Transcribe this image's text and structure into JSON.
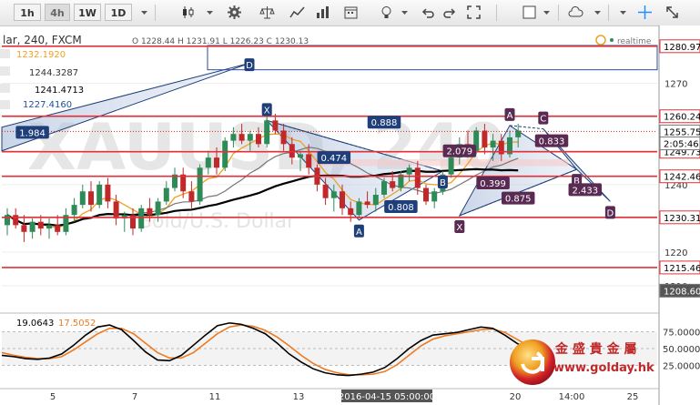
{
  "toolbar": {
    "timeframes": [
      "1h",
      "4h",
      "1W",
      "1D"
    ],
    "active_timeframe": "4h",
    "icons": [
      "dropdown-icon",
      "candlestick-icon",
      "dropdown-icon",
      "gear-icon",
      "scales-icon",
      "line-chart-icon",
      "bar-chart-icon",
      "calendar-icon",
      "lightbulb-icon",
      "dropdown-icon",
      "undo-icon",
      "redo-icon",
      "fullscreen-icon",
      "square-icon",
      "dropdown-icon",
      "cloud-icon",
      "dropdown-icon",
      "crosshair-icon",
      "expand-icon"
    ]
  },
  "header": {
    "symbol": "lar, 240, FXCM",
    "ohlc": "O 1228.44 H 1231.91 L 1226.23 C 1230.13",
    "indicator_values": [
      "1232.1920",
      "1244.3287",
      "1241.4713",
      "1227.4160"
    ],
    "indicator_colors": [
      "#f0a020",
      "#777777",
      "#000000",
      "#1f4e9c"
    ],
    "realtime_label": "realtime"
  },
  "watermark": {
    "big": "XAUUSD, 240",
    "small": "Gold/U.S. Dollar"
  },
  "colors": {
    "bull": "#2e8b57",
    "bear": "#c0282a",
    "pattern": "#1f3f7a",
    "resistance": "#e0323a",
    "ma_fast": "#f0a020",
    "ma_slow": "#777777",
    "ma_long": "#000000",
    "stoch_k": "#000000",
    "stoch_d": "#ee7a22"
  },
  "chart_data": {
    "type": "candlestick",
    "price_axis": {
      "ticks": [
        1270,
        1260,
        1250,
        1240,
        1230,
        1220,
        1210
      ],
      "ylim": [
        1202.5,
        1285.5
      ]
    },
    "x_axis": {
      "tick_labels": [
        "5",
        "7",
        "11",
        "13",
        "2016-04-15 05:00:00",
        "20",
        "14:00",
        "25"
      ]
    },
    "candles": [
      {
        "o": 1228,
        "h": 1233,
        "l": 1225,
        "c": 1231
      },
      {
        "o": 1231,
        "h": 1233,
        "l": 1227,
        "c": 1228
      },
      {
        "o": 1228,
        "h": 1231,
        "l": 1223,
        "c": 1226
      },
      {
        "o": 1226,
        "h": 1230,
        "l": 1224,
        "c": 1229
      },
      {
        "o": 1229,
        "h": 1231,
        "l": 1225,
        "c": 1227
      },
      {
        "o": 1227,
        "h": 1230,
        "l": 1224,
        "c": 1228
      },
      {
        "o": 1228,
        "h": 1231,
        "l": 1225,
        "c": 1226
      },
      {
        "o": 1226,
        "h": 1233,
        "l": 1225,
        "c": 1231
      },
      {
        "o": 1231,
        "h": 1236,
        "l": 1229,
        "c": 1234
      },
      {
        "o": 1234,
        "h": 1240,
        "l": 1233,
        "c": 1238
      },
      {
        "o": 1238,
        "h": 1241,
        "l": 1232,
        "c": 1234
      },
      {
        "o": 1234,
        "h": 1241,
        "l": 1233,
        "c": 1240
      },
      {
        "o": 1240,
        "h": 1242,
        "l": 1233,
        "c": 1235
      },
      {
        "o": 1235,
        "h": 1237,
        "l": 1228,
        "c": 1230
      },
      {
        "o": 1230,
        "h": 1232,
        "l": 1226,
        "c": 1231
      },
      {
        "o": 1231,
        "h": 1233,
        "l": 1225,
        "c": 1227
      },
      {
        "o": 1227,
        "h": 1234,
        "l": 1226,
        "c": 1233
      },
      {
        "o": 1233,
        "h": 1236,
        "l": 1229,
        "c": 1231
      },
      {
        "o": 1231,
        "h": 1236,
        "l": 1229,
        "c": 1235
      },
      {
        "o": 1235,
        "h": 1241,
        "l": 1234,
        "c": 1239
      },
      {
        "o": 1239,
        "h": 1245,
        "l": 1238,
        "c": 1243
      },
      {
        "o": 1243,
        "h": 1245,
        "l": 1236,
        "c": 1238
      },
      {
        "o": 1238,
        "h": 1241,
        "l": 1233,
        "c": 1235
      },
      {
        "o": 1235,
        "h": 1246,
        "l": 1234,
        "c": 1245
      },
      {
        "o": 1245,
        "h": 1250,
        "l": 1243,
        "c": 1248
      },
      {
        "o": 1248,
        "h": 1251,
        "l": 1243,
        "c": 1245
      },
      {
        "o": 1245,
        "h": 1254,
        "l": 1244,
        "c": 1253
      },
      {
        "o": 1253,
        "h": 1257,
        "l": 1251,
        "c": 1255
      },
      {
        "o": 1255,
        "h": 1258,
        "l": 1252,
        "c": 1253
      },
      {
        "o": 1253,
        "h": 1256,
        "l": 1250,
        "c": 1255
      },
      {
        "o": 1255,
        "h": 1257,
        "l": 1251,
        "c": 1252
      },
      {
        "o": 1252,
        "h": 1262,
        "l": 1251,
        "c": 1259
      },
      {
        "o": 1259,
        "h": 1261,
        "l": 1255,
        "c": 1256
      },
      {
        "o": 1256,
        "h": 1258,
        "l": 1250,
        "c": 1252
      },
      {
        "o": 1252,
        "h": 1254,
        "l": 1246,
        "c": 1248
      },
      {
        "o": 1248,
        "h": 1250,
        "l": 1244,
        "c": 1249
      },
      {
        "o": 1249,
        "h": 1252,
        "l": 1243,
        "c": 1245
      },
      {
        "o": 1245,
        "h": 1246,
        "l": 1238,
        "c": 1240
      },
      {
        "o": 1240,
        "h": 1242,
        "l": 1234,
        "c": 1236
      },
      {
        "o": 1236,
        "h": 1240,
        "l": 1232,
        "c": 1238
      },
      {
        "o": 1238,
        "h": 1240,
        "l": 1231,
        "c": 1233
      },
      {
        "o": 1233,
        "h": 1235,
        "l": 1229,
        "c": 1231
      },
      {
        "o": 1231,
        "h": 1236,
        "l": 1230,
        "c": 1235
      },
      {
        "o": 1235,
        "h": 1238,
        "l": 1233,
        "c": 1234
      },
      {
        "o": 1234,
        "h": 1239,
        "l": 1232,
        "c": 1237
      },
      {
        "o": 1237,
        "h": 1242,
        "l": 1236,
        "c": 1241
      },
      {
        "o": 1241,
        "h": 1244,
        "l": 1238,
        "c": 1239
      },
      {
        "o": 1239,
        "h": 1244,
        "l": 1238,
        "c": 1243
      },
      {
        "o": 1243,
        "h": 1246,
        "l": 1241,
        "c": 1245
      },
      {
        "o": 1245,
        "h": 1247,
        "l": 1237,
        "c": 1239
      },
      {
        "o": 1239,
        "h": 1240,
        "l": 1234,
        "c": 1235
      },
      {
        "o": 1235,
        "h": 1239,
        "l": 1233,
        "c": 1238
      },
      {
        "o": 1238,
        "h": 1244,
        "l": 1237,
        "c": 1243
      },
      {
        "o": 1243,
        "h": 1249,
        "l": 1242,
        "c": 1248
      },
      {
        "o": 1248,
        "h": 1254,
        "l": 1246,
        "c": 1252
      },
      {
        "o": 1252,
        "h": 1256,
        "l": 1248,
        "c": 1250
      },
      {
        "o": 1250,
        "h": 1257,
        "l": 1249,
        "c": 1256
      },
      {
        "o": 1256,
        "h": 1258,
        "l": 1249,
        "c": 1251
      },
      {
        "o": 1251,
        "h": 1255,
        "l": 1247,
        "c": 1253
      },
      {
        "o": 1253,
        "h": 1255,
        "l": 1247,
        "c": 1249
      },
      {
        "o": 1249,
        "h": 1256,
        "l": 1248,
        "c": 1254
      },
      {
        "o": 1254,
        "h": 1258,
        "l": 1251,
        "c": 1256
      }
    ],
    "horizontal_levels": [
      {
        "price": 1280.97,
        "color": "#e0323a",
        "label": "1280.97"
      },
      {
        "price": 1260.24,
        "color": "#e0323a",
        "label": "1260.24"
      },
      {
        "price": 1249.73,
        "color": "#e0323a",
        "label": "1249.73"
      },
      {
        "price": 1242.46,
        "color": "#e0323a",
        "label": "1242.46"
      },
      {
        "price": 1230.31,
        "color": "#e0323a",
        "label": "1230.31"
      },
      {
        "price": 1215.46,
        "color": "#e0323a",
        "label": "1215.46"
      }
    ],
    "price_tags": [
      {
        "price": 1255.75,
        "label": "1255.75",
        "bg": "#ffffff",
        "fg": "#000000"
      },
      {
        "price": 1252.2,
        "label": "2:05:46",
        "bg": "#ffffff",
        "fg": "#000000"
      },
      {
        "price": 1208.6,
        "label": "1208.60",
        "bg": "#555555",
        "fg": "#ffffff"
      }
    ],
    "pattern_points": [
      {
        "label": "X",
        "bar": 31,
        "price": 1259.0
      },
      {
        "label": "A",
        "bar": 42,
        "price": 1229.5
      },
      {
        "label": "B",
        "bar": 52,
        "price": 1244.0
      },
      {
        "label": "X",
        "bar": 54,
        "price": 1230.8
      },
      {
        "label": "A",
        "bar": 60,
        "price": 1257.5
      },
      {
        "label": "C",
        "bar": 64,
        "price": 1256.5
      },
      {
        "label": "B",
        "bar": 68,
        "price": 1244.5
      },
      {
        "label": "D",
        "bar": 72,
        "price": 1235.0
      }
    ],
    "ratios": [
      {
        "label": "0.888",
        "bar": 45,
        "price": 1258.5
      },
      {
        "label": "0.474",
        "bar": 39,
        "price": 1248.0
      },
      {
        "label": "2.079",
        "bar": 54,
        "price": 1250.0
      },
      {
        "label": "0.808",
        "bar": 47,
        "price": 1233.5
      },
      {
        "label": "0.833",
        "bar": 65,
        "price": 1253.0
      },
      {
        "label": "0.399",
        "bar": 58,
        "price": 1240.5
      },
      {
        "label": "2.433",
        "bar": 69,
        "price": 1238.5
      },
      {
        "label": "0.875",
        "bar": 61,
        "price": 1236.0
      },
      {
        "label": "1.984",
        "bar": 3,
        "price": 1255.5
      }
    ],
    "top_label": {
      "label": "D",
      "price": 1275.5
    },
    "stochastic": {
      "ticks": [
        75.0,
        50.0,
        25.0
      ],
      "tick_labels": [
        "75.0000",
        "50.0000",
        "25.0000"
      ],
      "k_label": "19.0643",
      "d_label": "17.5052",
      "k": [
        40,
        38,
        35,
        34,
        36,
        42,
        55,
        70,
        82,
        85,
        78,
        62,
        45,
        33,
        32,
        40,
        55,
        70,
        84,
        88,
        86,
        80,
        72,
        58,
        42,
        30,
        20,
        14,
        11,
        10,
        12,
        15,
        22,
        35,
        50,
        62,
        70,
        72,
        74,
        78,
        82,
        80,
        70,
        58,
        48,
        42
      ],
      "d": [
        44,
        40,
        37,
        35,
        35,
        38,
        48,
        60,
        72,
        80,
        80,
        72,
        58,
        44,
        36,
        36,
        44,
        58,
        72,
        82,
        85,
        83,
        77,
        67,
        54,
        40,
        28,
        19,
        14,
        11,
        11,
        12,
        16,
        26,
        40,
        54,
        64,
        69,
        72,
        75,
        78,
        79,
        74,
        64,
        54,
        46
      ]
    }
  },
  "logo": {
    "name": "金 盛 貴 金 屬",
    "url": "www.golday.hk"
  }
}
